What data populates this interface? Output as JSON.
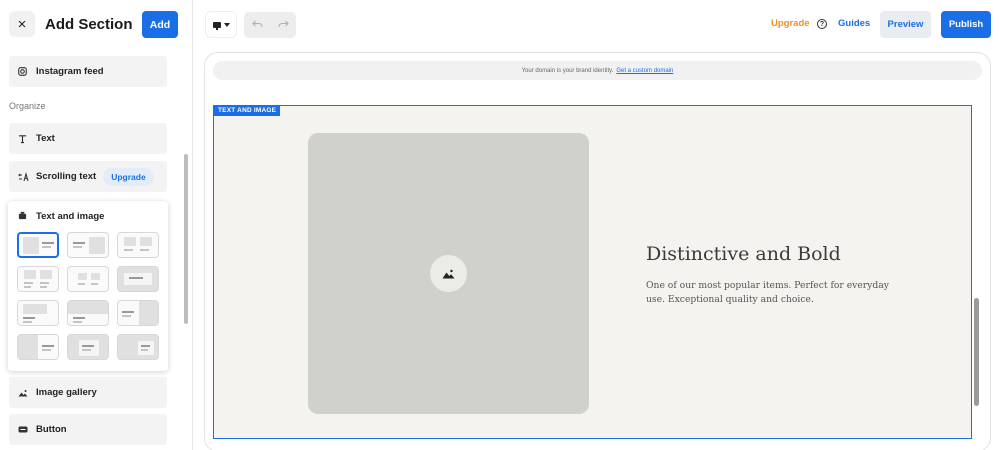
{
  "left_panel": {
    "close_icon": "×",
    "title": "Add Section",
    "add_label": "Add",
    "items_top": [
      {
        "label": "Instagram feed",
        "icon": "instagram-icon"
      }
    ],
    "group_label": "Organize",
    "items_organize": [
      {
        "label": "Text",
        "icon": "text-icon"
      },
      {
        "label": "Scrolling text",
        "icon": "scrolling-text-icon",
        "badge": "Upgrade"
      }
    ],
    "text_and_image": {
      "label": "Text and image",
      "icon": "text-image-icon",
      "layout_count": 12,
      "selected_index": 0
    },
    "items_bottom": [
      {
        "label": "Image gallery",
        "icon": "image-gallery-icon"
      },
      {
        "label": "Button",
        "icon": "button-icon"
      }
    ]
  },
  "topbar": {
    "device_icon": "desktop-icon",
    "undo_icon": "undo-icon",
    "redo_icon": "redo-icon",
    "upgrade_label": "Upgrade",
    "help_icon": "help-icon",
    "guides_label": "Guides",
    "preview_label": "Preview",
    "publish_label": "Publish"
  },
  "canvas": {
    "domain_text": "Your domain is your brand identity.",
    "domain_link": "Get a custom domain",
    "section_tag": "TEXT AND IMAGE",
    "heading": "Distinctive and Bold",
    "body": "One of our most popular items. Perfect for everyday use. Exceptional quality and choice.",
    "image_icon": "image-placeholder-icon"
  },
  "colors": {
    "accent": "#1a6fe8",
    "upgrade": "#e8922a",
    "section_bg": "#f4f3ef",
    "placeholder": "#d1d1cc"
  }
}
